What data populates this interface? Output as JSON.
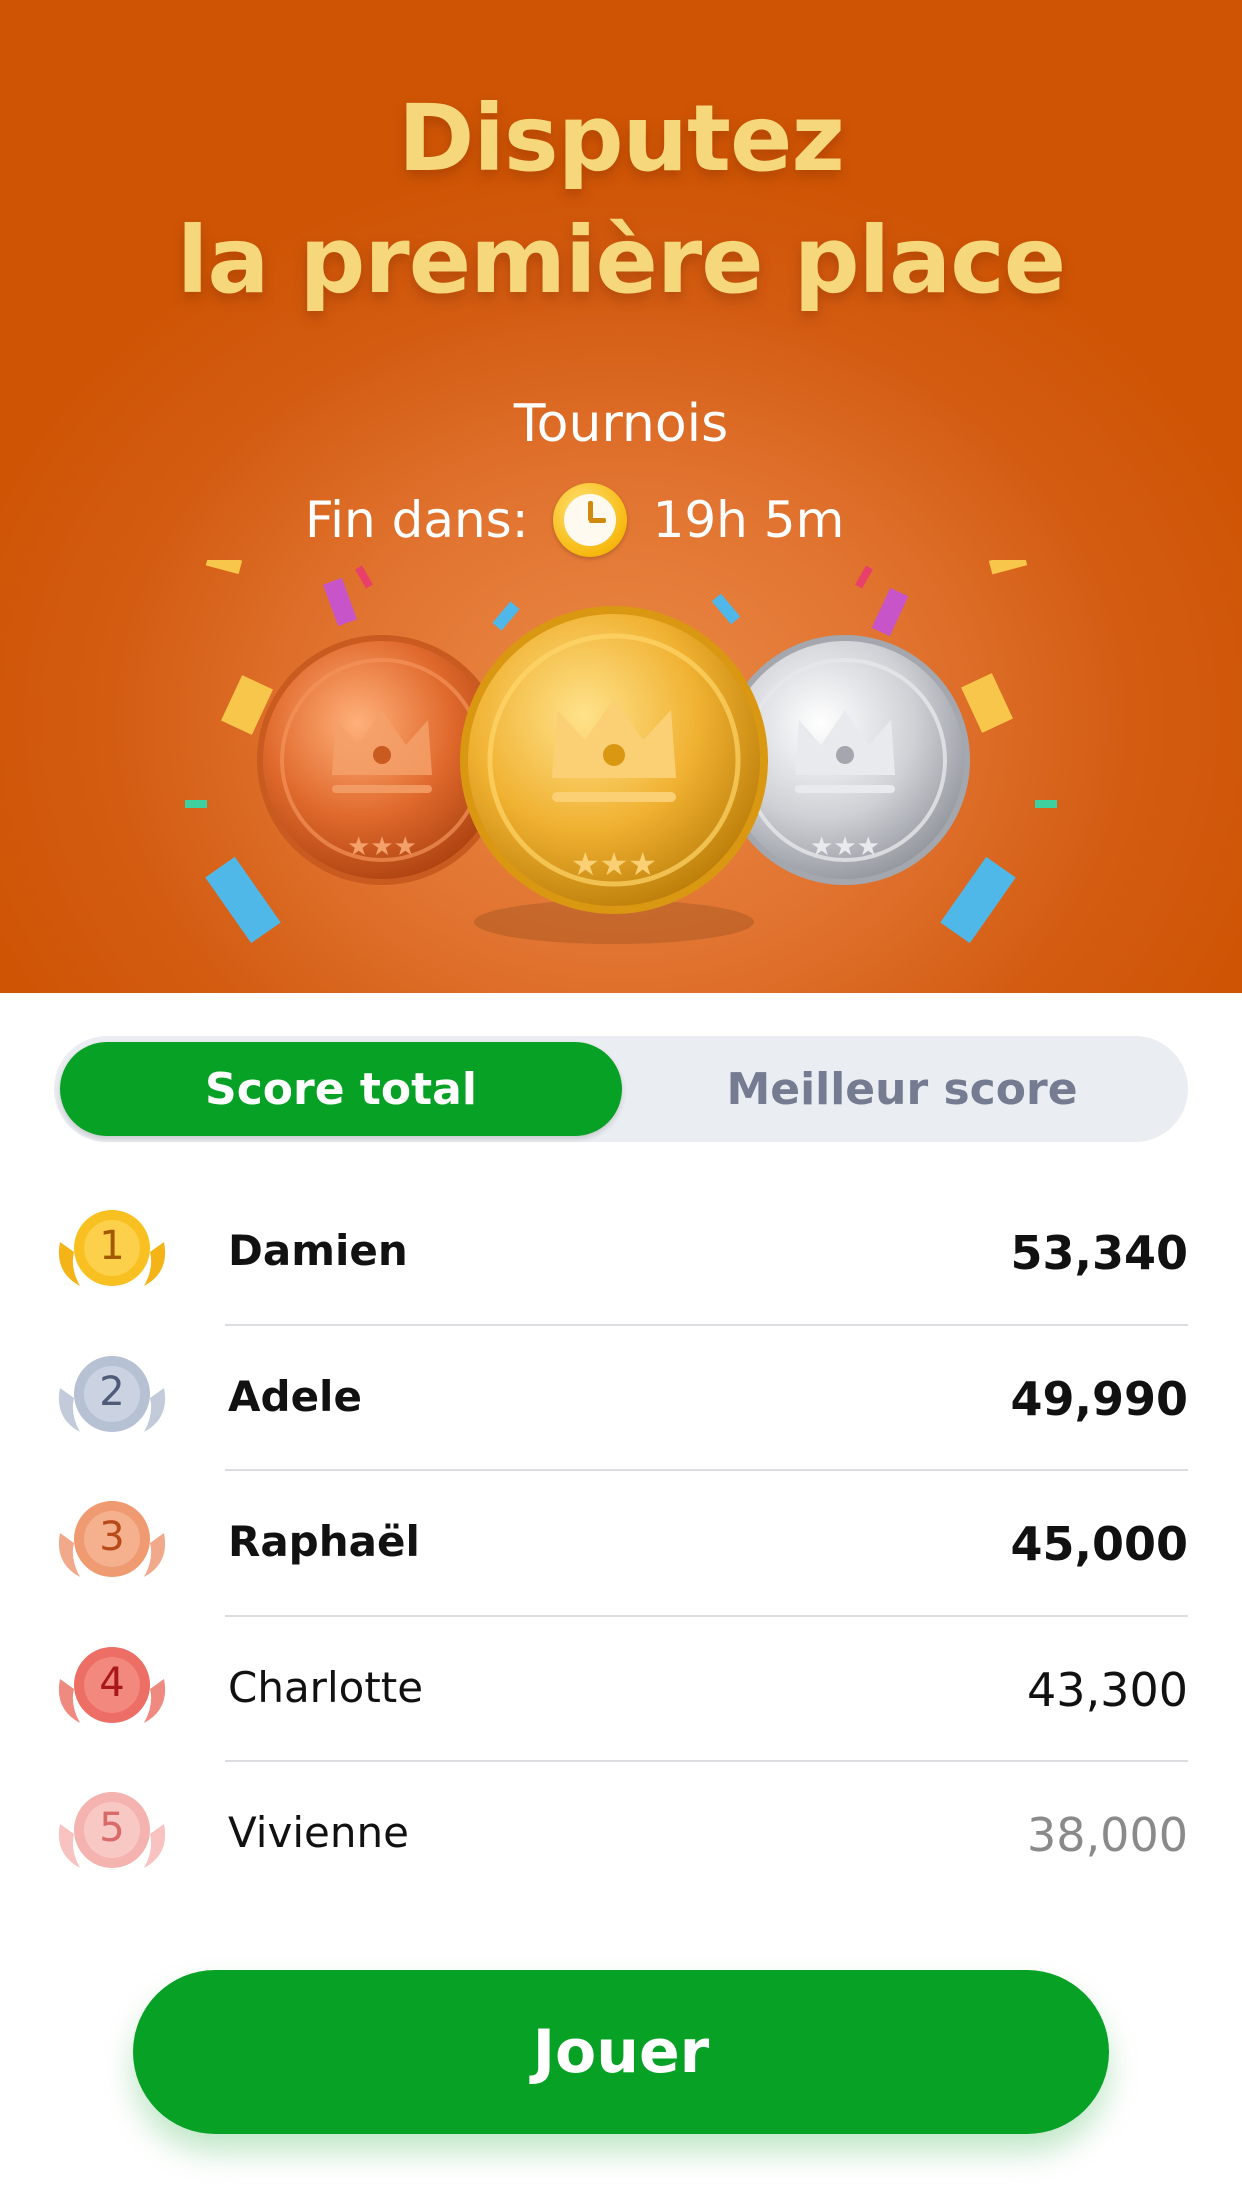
{
  "hero": {
    "title_line1": "Disputez",
    "title_line2": "la première place",
    "subtitle": "Tournois",
    "timer_label": "Fin dans:",
    "timer_value": "19h 5m",
    "timer_icon": "clock-icon",
    "medals": [
      "bronze-medal-icon",
      "gold-medal-icon",
      "silver-medal-icon"
    ]
  },
  "tabs": {
    "active": "Score total",
    "inactive": "Meilleur score"
  },
  "leaderboard": [
    {
      "rank": "1",
      "name": "Damien",
      "score": "53,340",
      "badge": "gold"
    },
    {
      "rank": "2",
      "name": "Adele",
      "score": "49,990",
      "badge": "silver"
    },
    {
      "rank": "3",
      "name": "Raphaël",
      "score": "45,000",
      "badge": "bronze"
    },
    {
      "rank": "4",
      "name": "Charlotte",
      "score": "43,300",
      "badge": "red"
    },
    {
      "rank": "5",
      "name": "Vivienne",
      "score": "38,000",
      "badge": "pink"
    }
  ],
  "play_button": "Jouer",
  "colors": {
    "accent_green": "#06a125",
    "hero_orange": "#cf5505",
    "title_gold": "#f6d77c"
  }
}
